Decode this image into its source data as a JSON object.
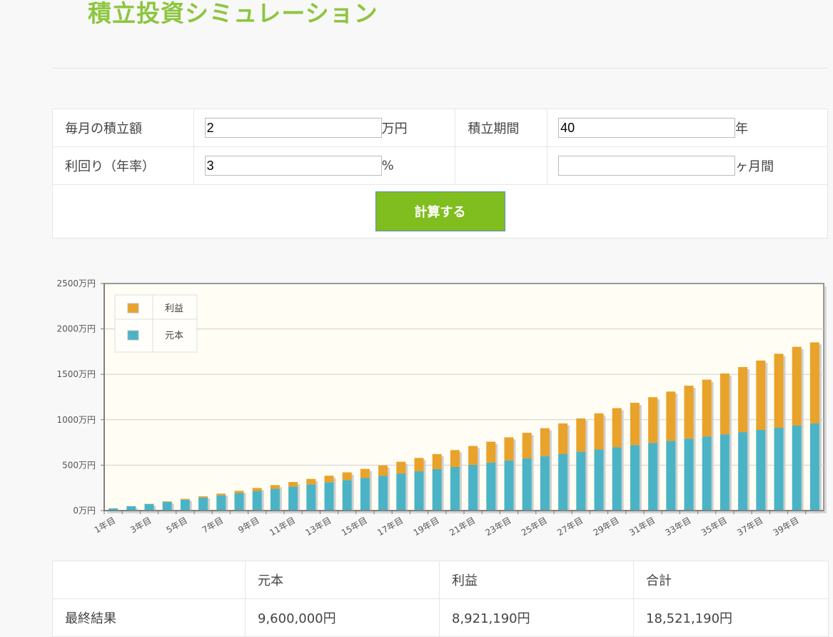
{
  "page": {
    "title": "積立投資シミュレーション"
  },
  "form": {
    "monthly_label": "毎月の積立額",
    "monthly_value": "2",
    "monthly_unit": "万円",
    "period_label": "積立期間",
    "period_value": "40",
    "period_unit": "年",
    "rate_label": "利回り（年率）",
    "rate_value": "3",
    "rate_unit": "%",
    "months_value": "",
    "months_unit": "ヶ月間",
    "calc_button": "計算する"
  },
  "colors": {
    "principal": "#4bb3c6",
    "profit": "#e9a22a",
    "accent": "#8cc63f",
    "button": "#80bd1e",
    "plot_bg": "#fffdf4"
  },
  "chart_data": {
    "type": "bar",
    "stacked": true,
    "y_unit": "万円",
    "ylim": [
      0,
      2500
    ],
    "yticks": [
      0,
      500,
      1000,
      1500,
      2000,
      2500
    ],
    "ytick_labels": [
      "0万円",
      "500万円",
      "1000万円",
      "1500万円",
      "2000万円",
      "2500万円"
    ],
    "categories": [
      "1年目",
      "2年目",
      "3年目",
      "4年目",
      "5年目",
      "6年目",
      "7年目",
      "8年目",
      "9年目",
      "10年目",
      "11年目",
      "12年目",
      "13年目",
      "14年目",
      "15年目",
      "16年目",
      "17年目",
      "18年目",
      "19年目",
      "20年目",
      "21年目",
      "22年目",
      "23年目",
      "24年目",
      "25年目",
      "26年目",
      "27年目",
      "28年目",
      "29年目",
      "30年目",
      "31年目",
      "32年目",
      "33年目",
      "34年目",
      "35年目",
      "36年目",
      "37年目",
      "38年目",
      "39年目",
      "40年目"
    ],
    "shown_x_labels": [
      "1年目",
      "3年目",
      "5年目",
      "7年目",
      "9年目",
      "11年目",
      "13年目",
      "15年目",
      "17年目",
      "19年目",
      "21年目",
      "23年目",
      "25年目",
      "27年目",
      "29年目",
      "31年目",
      "33年目",
      "35年目",
      "37年目",
      "39年目"
    ],
    "legend": {
      "position": "top-left"
    },
    "grid": true,
    "series": [
      {
        "name": "元本",
        "values": [
          24,
          48,
          72,
          96,
          120,
          144,
          168,
          192,
          216,
          240,
          264,
          288,
          312,
          336,
          360,
          384,
          408,
          432,
          456,
          480,
          504,
          528,
          552,
          576,
          600,
          624,
          648,
          672,
          696,
          720,
          744,
          768,
          792,
          816,
          840,
          864,
          888,
          912,
          936,
          960
        ]
      },
      {
        "name": "利益",
        "values": [
          0.4,
          1.4,
          3.2,
          5.8,
          9.3,
          13.7,
          19.0,
          25.3,
          32.6,
          40.9,
          50.2,
          60.6,
          72.1,
          84.8,
          98.6,
          113.6,
          129.8,
          147.3,
          166.0,
          186.1,
          207.6,
          230.4,
          254.6,
          280.3,
          307.5,
          336.2,
          366.5,
          398.4,
          431.9,
          467.1,
          504.0,
          542.7,
          583.2,
          625.6,
          669.9,
          716.1,
          764.3,
          814.6,
          867.0,
          892.1
        ]
      }
    ]
  },
  "results": {
    "headers": [
      "",
      "元本",
      "利益",
      "合計"
    ],
    "row_label": "最終結果",
    "principal": "9,600,000円",
    "profit": "8,921,190円",
    "total": "18,521,190円"
  }
}
